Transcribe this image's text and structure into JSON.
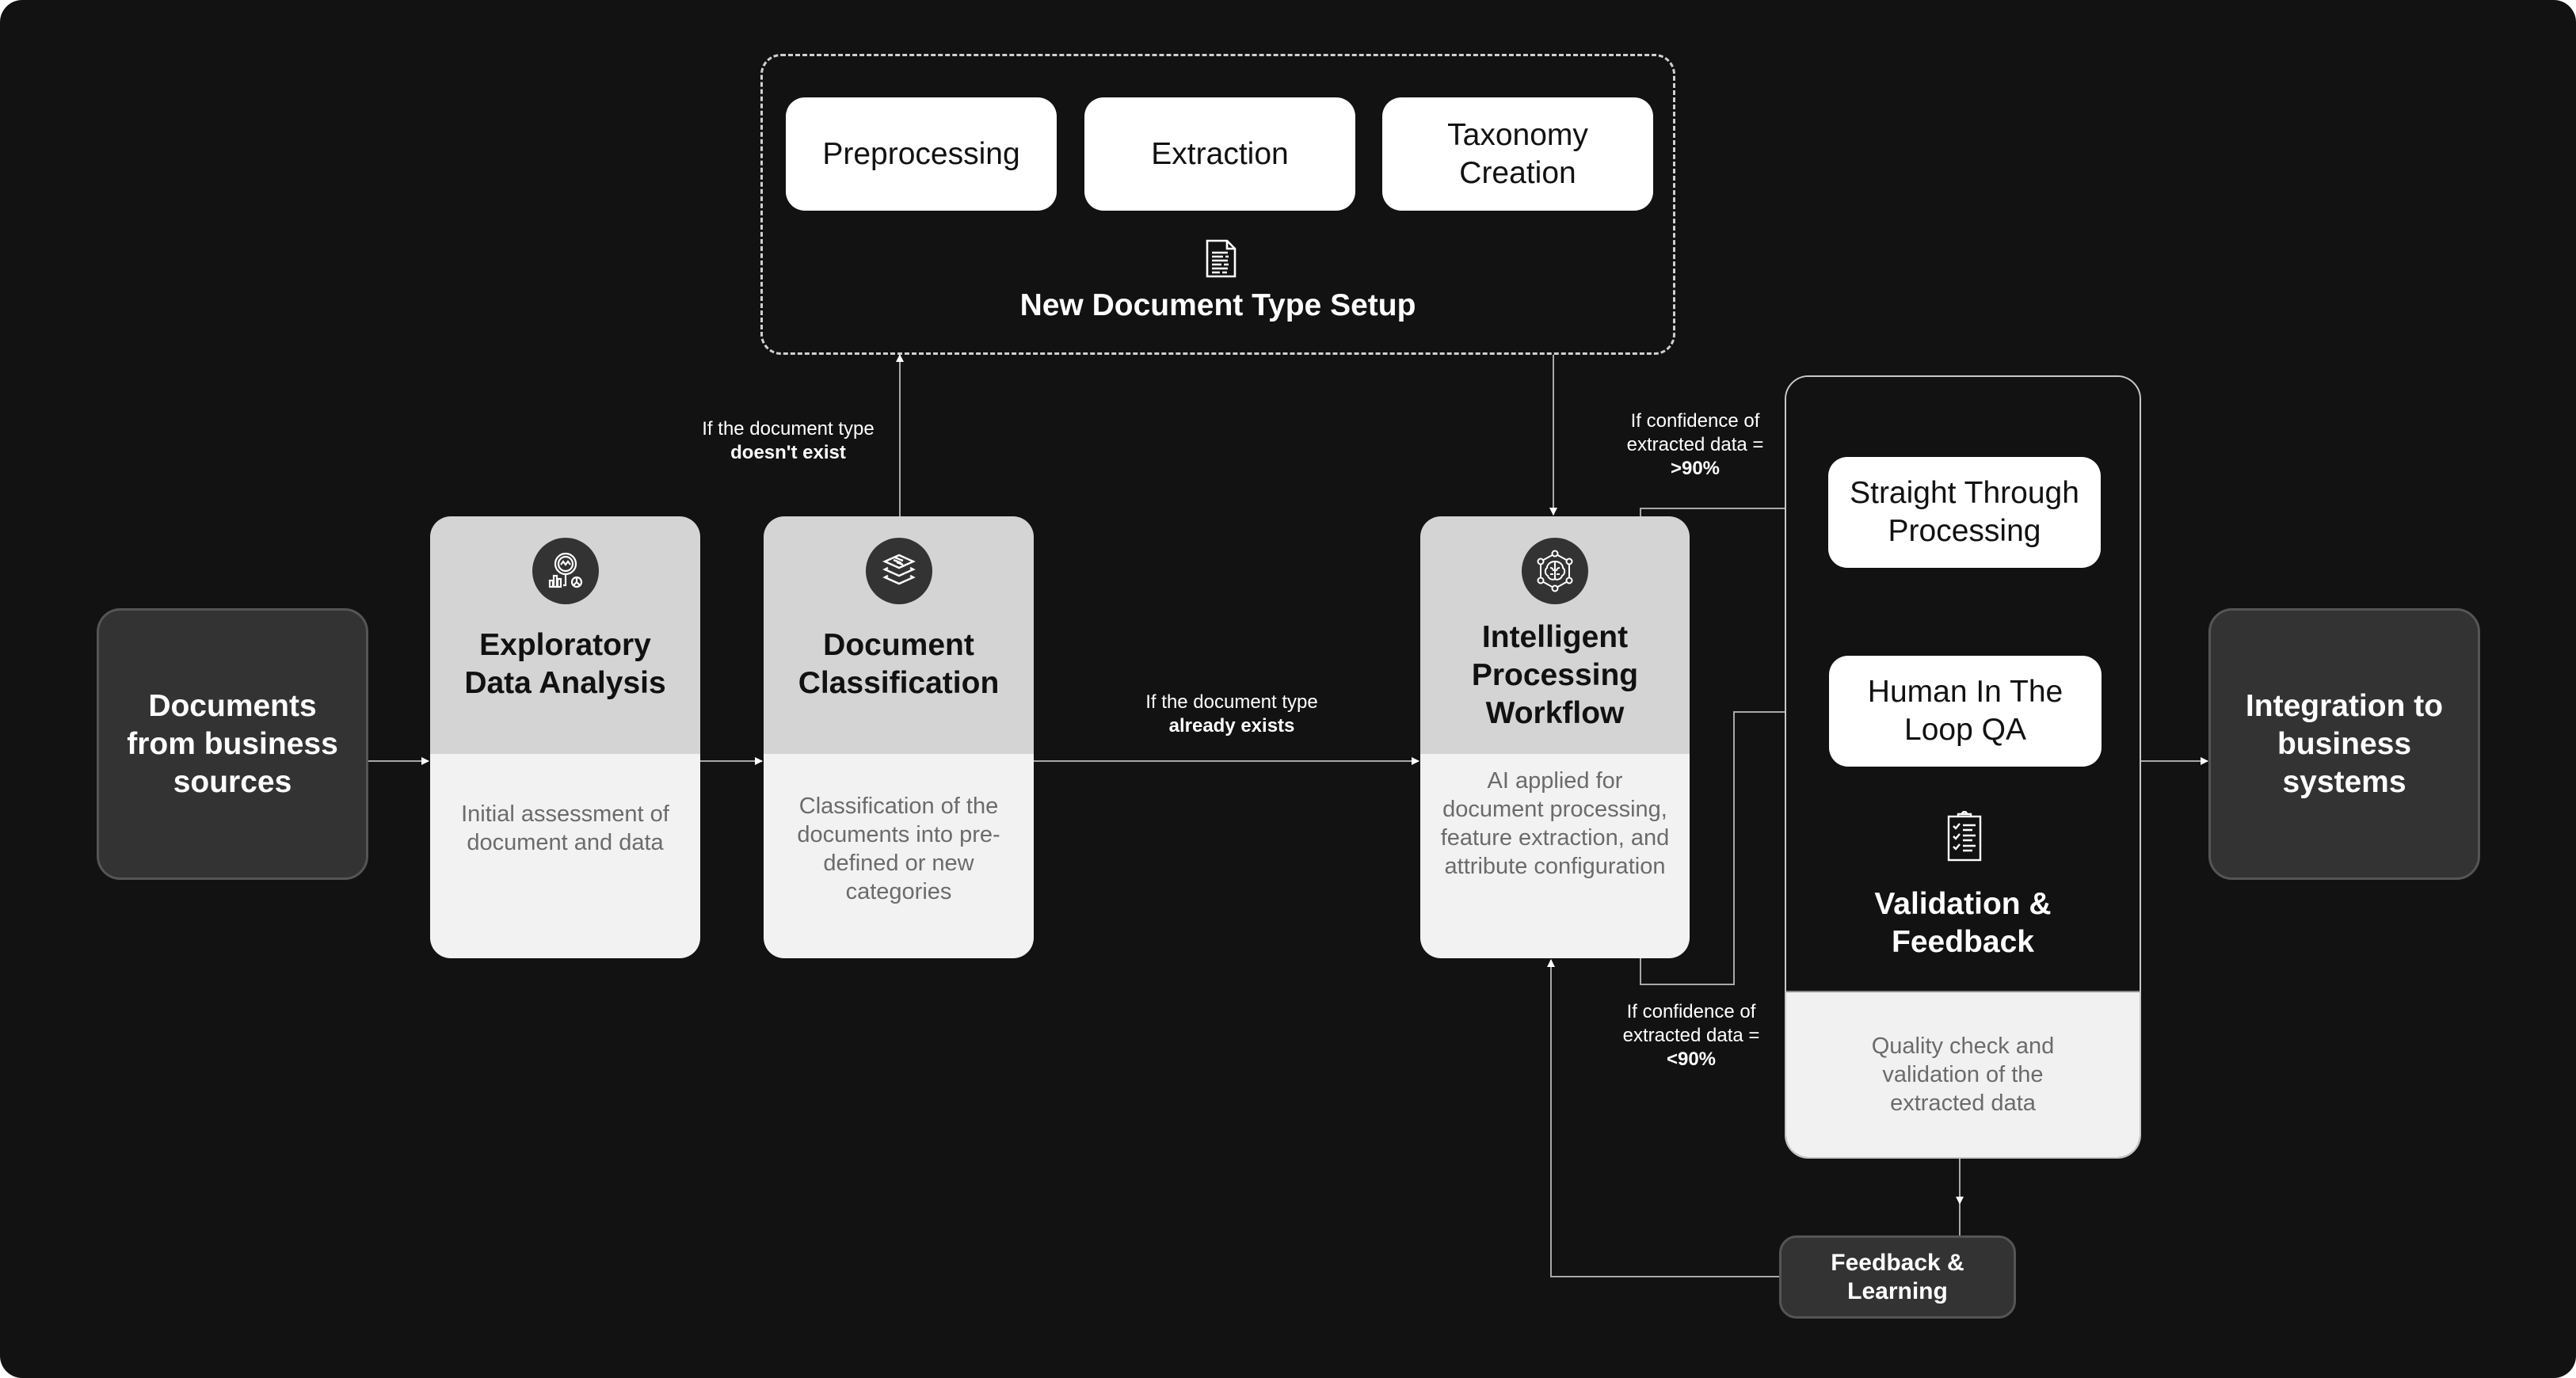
{
  "source": {
    "title": "Documents from business sources"
  },
  "stages": [
    {
      "title": "Exploratory Data Analysis",
      "icon": "data-analysis-icon",
      "description": "Initial assessment of document and data"
    },
    {
      "title": "Document Classification",
      "icon": "layers-icon",
      "description": "Classification of the documents into pre-defined or new categories"
    },
    {
      "title": "Intelligent Processing Workflow",
      "icon": "ai-brain-network-icon",
      "description": "AI applied for document processing, feature extraction, and attribute configuration"
    }
  ],
  "new_type_setup": {
    "title": "New Document Type Setup",
    "icon": "document-icon",
    "steps": [
      "Preprocessing",
      "Extraction",
      "Taxonomy Creation"
    ]
  },
  "conditions": {
    "not_exists": {
      "line1": "If the document type",
      "emphasis": "doesn't exist"
    },
    "exists": {
      "line1": "If the document type",
      "emphasis": "already exists"
    },
    "high_conf": {
      "line1": "If confidence of",
      "line2": "extracted data =",
      "emphasis": ">90%"
    },
    "low_conf": {
      "line1": "If confidence of",
      "line2": "extracted data =",
      "emphasis": "<90%"
    }
  },
  "validation": {
    "title": "Validation & Feedback",
    "icon": "clipboard-checklist-icon",
    "options": [
      "Straight Through Processing",
      "Human In The Loop QA"
    ],
    "description": "Quality check and validation of the extracted data"
  },
  "feedback": {
    "title": "Feedback & Learning"
  },
  "destination": {
    "title": "Integration to business systems"
  },
  "colors": {
    "background": "#121212",
    "card_header": "#d4d4d4",
    "card_body": "#f2f2f2",
    "terminal": "#333333",
    "line": "#bdbdbd"
  }
}
